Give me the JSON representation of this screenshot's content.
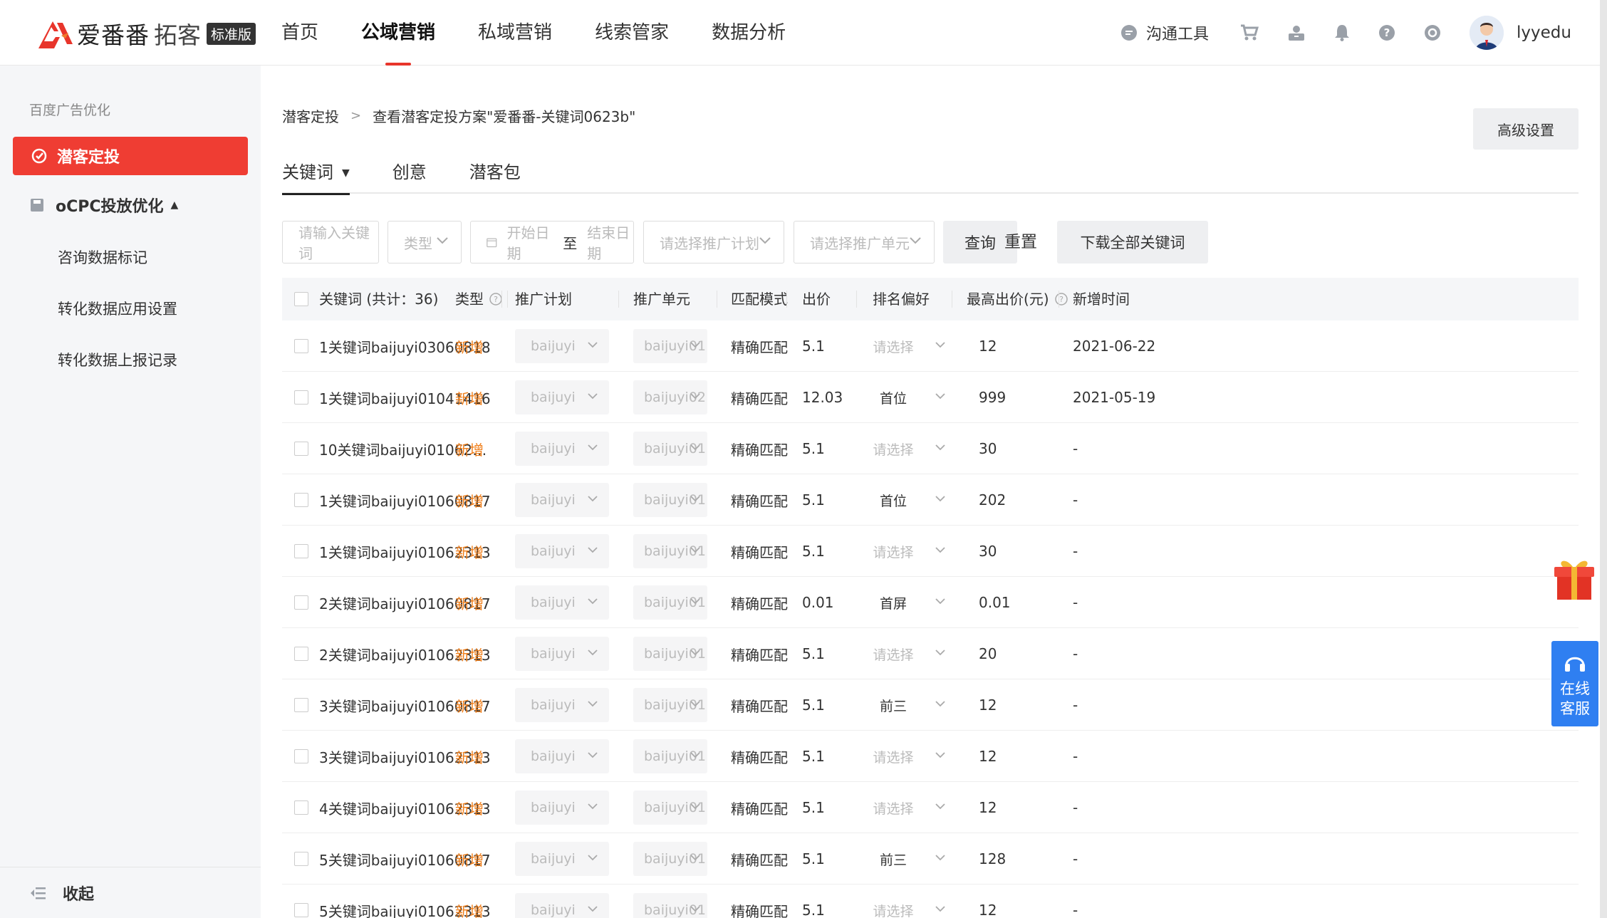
{
  "header": {
    "brand": "爱番番",
    "brand_sub": "拓客",
    "edition": "标准版",
    "nav": [
      "首页",
      "公域营销",
      "私域营销",
      "线索管家",
      "数据分析"
    ],
    "active_nav": 1,
    "comm_tool": "沟通工具",
    "username": "lyyedu"
  },
  "sidebar": {
    "section": "百度广告优化",
    "active_item": "潜客定投",
    "group": "oCPC投放优化",
    "sub_items": [
      "咨询数据标记",
      "转化数据应用设置",
      "转化数据上报记录"
    ],
    "collapse": "收起"
  },
  "main": {
    "breadcrumb": [
      "潜客定投",
      "查看潜客定投方案\"爱番番-关键词0623b\""
    ],
    "advanced_button": "高级设置",
    "tabs": [
      "关键词",
      "创意",
      "潜客包"
    ],
    "filters": {
      "keyword_placeholder": "请输入关键词",
      "type_placeholder": "类型",
      "start_date": "开始日期",
      "date_to": "至",
      "end_date": "结束日期",
      "plan_placeholder": "请选择推广计划",
      "unit_placeholder": "请选择推广单元",
      "query": "查询",
      "reset": "重置",
      "download": "下载全部关键词"
    },
    "table": {
      "headers": {
        "keyword": "关键词 (共计：36)",
        "type": "类型",
        "plan": "推广计划",
        "unit": "推广单元",
        "match": "匹配模式",
        "bid": "出价",
        "rank": "排名偏好",
        "max_bid": "最高出价(元)",
        "added": "新增时间"
      },
      "rows": [
        {
          "keyword": "1关键词baijuyi03060818",
          "type": "新增",
          "plan": "baijuyi",
          "unit": "baijuyi01",
          "match": "精确匹配",
          "bid": "5.1",
          "rank": "请选择",
          "max_bid": "12",
          "added": "2021-06-22"
        },
        {
          "keyword": "1关键词baijuyi01041416",
          "type": "新增",
          "plan": "baijuyi",
          "unit": "baijuyi02",
          "match": "精确匹配",
          "bid": "12.03",
          "rank": "首位",
          "max_bid": "999",
          "added": "2021-05-19"
        },
        {
          "keyword": "10关键词baijuyi01062…",
          "type": "新增",
          "plan": "baijuyi",
          "unit": "baijuyi01",
          "match": "精确匹配",
          "bid": "5.1",
          "rank": "请选择",
          "max_bid": "30",
          "added": "-"
        },
        {
          "keyword": "1关键词baijuyi01060817",
          "type": "新增",
          "plan": "baijuyi",
          "unit": "baijuyi01",
          "match": "精确匹配",
          "bid": "5.1",
          "rank": "首位",
          "max_bid": "202",
          "added": "-"
        },
        {
          "keyword": "1关键词baijuyi01062313",
          "type": "新增",
          "plan": "baijuyi",
          "unit": "baijuyi01",
          "match": "精确匹配",
          "bid": "5.1",
          "rank": "请选择",
          "max_bid": "30",
          "added": "-"
        },
        {
          "keyword": "2关键词baijuyi01060817",
          "type": "新增",
          "plan": "baijuyi",
          "unit": "baijuyi01",
          "match": "精确匹配",
          "bid": "0.01",
          "rank": "首屏",
          "max_bid": "0.01",
          "added": "-"
        },
        {
          "keyword": "2关键词baijuyi01062313",
          "type": "新增",
          "plan": "baijuyi",
          "unit": "baijuyi01",
          "match": "精确匹配",
          "bid": "5.1",
          "rank": "请选择",
          "max_bid": "20",
          "added": "-"
        },
        {
          "keyword": "3关键词baijuyi01060817",
          "type": "新增",
          "plan": "baijuyi",
          "unit": "baijuyi01",
          "match": "精确匹配",
          "bid": "5.1",
          "rank": "前三",
          "max_bid": "12",
          "added": "-"
        },
        {
          "keyword": "3关键词baijuyi01062313",
          "type": "新增",
          "plan": "baijuyi",
          "unit": "baijuyi01",
          "match": "精确匹配",
          "bid": "5.1",
          "rank": "请选择",
          "max_bid": "12",
          "added": "-"
        },
        {
          "keyword": "4关键词baijuyi01062313",
          "type": "新增",
          "plan": "baijuyi",
          "unit": "baijuyi01",
          "match": "精确匹配",
          "bid": "5.1",
          "rank": "请选择",
          "max_bid": "12",
          "added": "-"
        },
        {
          "keyword": "5关键词baijuyi01060817",
          "type": "新增",
          "plan": "baijuyi",
          "unit": "baijuyi01",
          "match": "精确匹配",
          "bid": "5.1",
          "rank": "前三",
          "max_bid": "128",
          "added": "-"
        },
        {
          "keyword": "5关键词baijuyi01062313",
          "type": "新增",
          "plan": "baijuyi",
          "unit": "baijuyi01",
          "match": "精确匹配",
          "bid": "5.1",
          "rank": "请选择",
          "max_bid": "12",
          "added": "-"
        }
      ]
    }
  },
  "widgets": {
    "service_label_1": "在线",
    "service_label_2": "客服"
  },
  "colors": {
    "brand_red": "#ef3d33",
    "new_orange": "#f07d17",
    "service_blue": "#2f7ff1"
  }
}
